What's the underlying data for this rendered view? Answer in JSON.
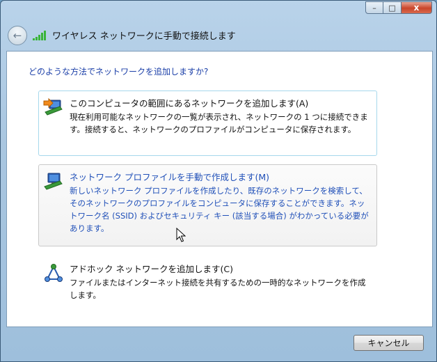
{
  "window": {
    "title": "ワイヤレス ネットワークに手動で接続します",
    "caption_min": "–",
    "caption_max": "□",
    "caption_close": "x"
  },
  "question": "どのような方法でネットワークを追加しますか?",
  "options": [
    {
      "title": "このコンピュータの範囲にあるネットワークを追加します(A)",
      "desc": "現在利用可能なネットワークの一覧が表示され、ネットワークの 1 つに接続できます。接続すると、ネットワークのプロファイルがコンピュータに保存されます。",
      "icon": "network-arrow-icon"
    },
    {
      "title": "ネットワーク プロファイルを手動で作成します(M)",
      "desc": "新しいネットワーク プロファイルを作成したり、既存のネットワークを検索して、そのネットワークのプロファイルをコンピュータに保存することができます。ネットワーク名 (SSID) およびセキュリティ キー (該当する場合) がわかっている必要があります。",
      "icon": "network-profile-icon"
    },
    {
      "title": "アドホック ネットワークを追加します(C)",
      "desc": "ファイルまたはインターネット接続を共有するための一時的なネットワークを作成します。",
      "icon": "adhoc-network-icon"
    }
  ],
  "footer": {
    "cancel_label": "キャンセル"
  }
}
